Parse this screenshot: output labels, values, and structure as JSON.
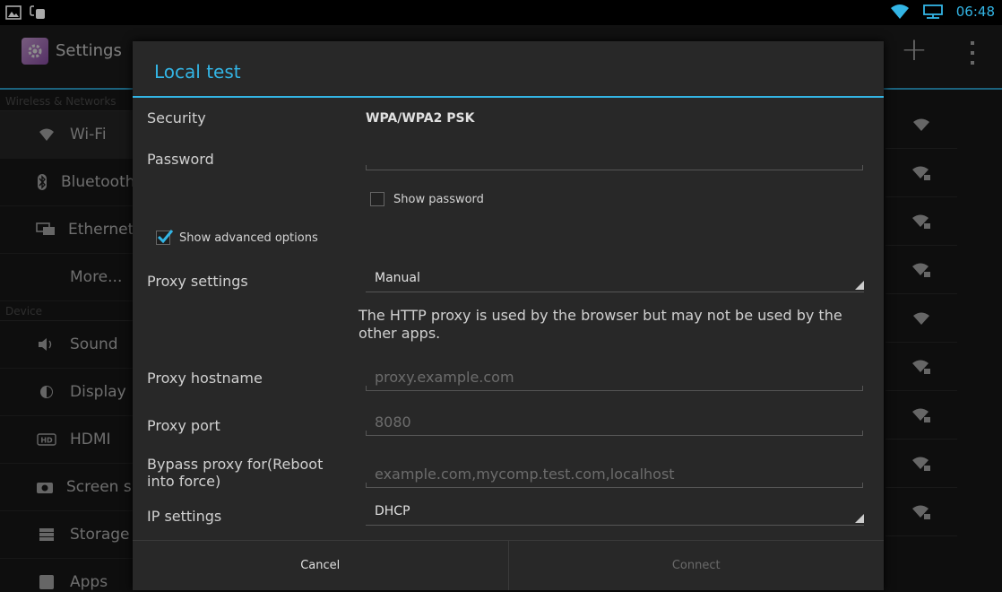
{
  "status_bar": {
    "time": "06:48",
    "icons": [
      "gallery-icon",
      "usb-debug-icon",
      "wifi-icon",
      "ethernet-icon"
    ]
  },
  "app": {
    "title": "Settings",
    "sections": [
      {
        "header": "Wireless & Networks",
        "items": [
          {
            "label": "Wi-Fi",
            "icon": "wifi-icon"
          },
          {
            "label": "Bluetooth",
            "icon": "bluetooth-icon"
          },
          {
            "label": "Ethernet",
            "icon": "ethernet-icon"
          },
          {
            "label": "More...",
            "icon": ""
          }
        ]
      },
      {
        "header": "Device",
        "items": [
          {
            "label": "Sound",
            "icon": "speaker-icon"
          },
          {
            "label": "Display",
            "icon": "brightness-icon"
          },
          {
            "label": "HDMI",
            "icon": "hdmi-icon"
          },
          {
            "label": "Screen shot",
            "icon": "camera-icon"
          },
          {
            "label": "Storage",
            "icon": "storage-icon"
          },
          {
            "label": "Apps",
            "icon": "apps-icon"
          }
        ]
      }
    ],
    "accent_color": "#33b5e5"
  },
  "dialog": {
    "title": "Local test",
    "security_label": "Security",
    "security_value": "WPA/WPA2 PSK",
    "password_label": "Password",
    "password_value": "",
    "show_password_label": "Show password",
    "show_password_checked": false,
    "show_advanced_label": "Show advanced options",
    "show_advanced_checked": true,
    "proxy_settings_label": "Proxy settings",
    "proxy_settings_value": "Manual",
    "proxy_note": "The HTTP proxy is used by the browser but may not be used by the other apps.",
    "proxy_hostname_label": "Proxy hostname",
    "proxy_hostname_placeholder": "proxy.example.com",
    "proxy_port_label": "Proxy port",
    "proxy_port_placeholder": "8080",
    "bypass_label": "Bypass proxy for(Reboot into force)",
    "bypass_placeholder": "example.com,mycomp.test.com,localhost",
    "ip_settings_label": "IP settings",
    "ip_settings_value": "DHCP",
    "cancel_label": "Cancel",
    "connect_label": "Connect"
  }
}
